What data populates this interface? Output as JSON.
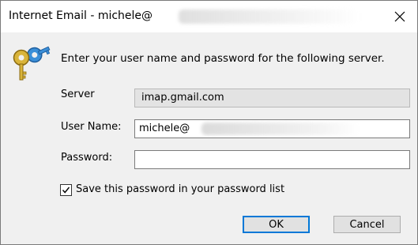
{
  "window": {
    "title": "Internet Email - michele@"
  },
  "prompt": "Enter your user name and password for the following server.",
  "server": {
    "label": "Server",
    "value": "imap.gmail.com"
  },
  "username": {
    "label": "User Name:",
    "value": "michele@"
  },
  "password": {
    "label": "Password:",
    "value": ""
  },
  "save_password": {
    "label": "Save this password in your password list",
    "checked": true
  },
  "buttons": {
    "ok": "OK",
    "cancel": "Cancel"
  },
  "icons": {
    "close": "close-icon",
    "keys": "keys-icon",
    "check": "check-icon"
  },
  "colors": {
    "accent": "#0078d7",
    "dialog_bg": "#f0f0f0",
    "key_gold": "#d9b43a",
    "key_blue": "#3b8fd8"
  }
}
